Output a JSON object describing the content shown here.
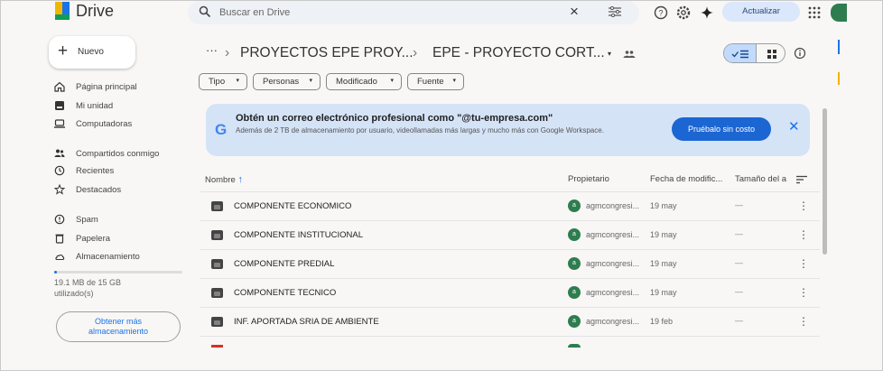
{
  "app": {
    "name": "Drive"
  },
  "search": {
    "placeholder": "Buscar en Drive"
  },
  "header": {
    "update_label": "Actualizar"
  },
  "sidebar": {
    "new_label": "Nuevo",
    "items": [
      {
        "label": "Página principal",
        "icon": "home-icon"
      },
      {
        "label": "Mi unidad",
        "icon": "my-drive-icon"
      },
      {
        "label": "Computadoras",
        "icon": "computer-icon"
      },
      {
        "label": "Compartidos conmigo",
        "icon": "shared-icon"
      },
      {
        "label": "Recientes",
        "icon": "clock-icon"
      },
      {
        "label": "Destacados",
        "icon": "star-icon"
      },
      {
        "label": "Spam",
        "icon": "spam-icon"
      },
      {
        "label": "Papelera",
        "icon": "trash-icon"
      },
      {
        "label": "Almacenamiento",
        "icon": "cloud-icon"
      }
    ],
    "storage_used_fraction": 0.0127,
    "storage_line1": "19.1 MB de 15 GB",
    "storage_line2": "utilizado(s)",
    "more_storage_line1": "Obtener más",
    "more_storage_line2": "almacenamiento"
  },
  "breadcrumb": {
    "ellipsis": "···",
    "parent": "PROYECTOS EPE PROY...",
    "current": "EPE - PROYECTO CORT..."
  },
  "filters": [
    "Tipo",
    "Personas",
    "Modificado",
    "Fuente"
  ],
  "banner": {
    "title": "Obtén un correo electrónico profesional como \"@tu-empresa.com\"",
    "description": "Además de 2 TB de almacenamiento por usuario, videollamadas más largas y mucho más con Google Workspace.",
    "cta": "Pruébalo sin costo"
  },
  "table": {
    "headers": {
      "name": "Nombre",
      "owner": "Propietario",
      "modified": "Fecha de modific...",
      "size": "Tamaño del a"
    },
    "rows": [
      {
        "name": "COMPONENTE ECONOMICO",
        "owner": "agmcongresi...",
        "modified": "19 may",
        "size": "—",
        "avatar": "a"
      },
      {
        "name": "COMPONENTE INSTITUCIONAL",
        "owner": "agmcongresi...",
        "modified": "19 may",
        "size": "—",
        "avatar": "a"
      },
      {
        "name": "COMPONENTE PREDIAL",
        "owner": "agmcongresi...",
        "modified": "19 may",
        "size": "—",
        "avatar": "a"
      },
      {
        "name": "COMPONENTE TECNICO",
        "owner": "agmcongresi...",
        "modified": "19 may",
        "size": "—",
        "avatar": "a"
      },
      {
        "name": "INF. APORTADA SRIA DE AMBIENTE",
        "owner": "agmcongresi...",
        "modified": "19 feb",
        "size": "—",
        "avatar": "a"
      }
    ]
  },
  "colors": {
    "accent": "#1a73e8",
    "banner_bg": "#d5e3f7",
    "cta_bg": "#1b66d2",
    "owner_avatar": "#2e7d4f"
  }
}
